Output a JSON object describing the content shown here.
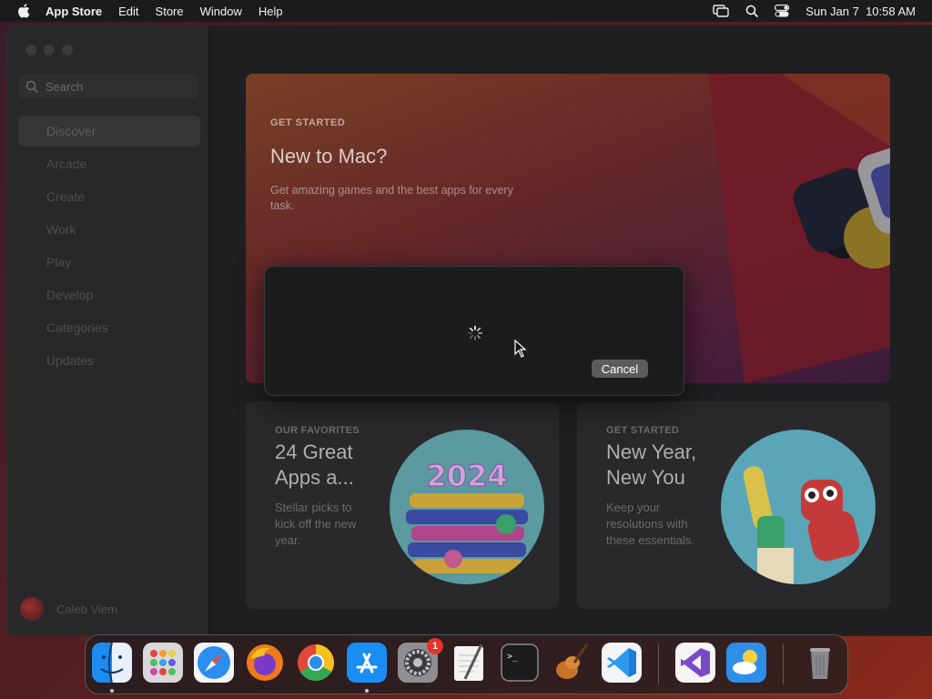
{
  "menubar": {
    "apple_icon": "apple-logo-icon",
    "app_name": "App Store",
    "menus": [
      "Edit",
      "Store",
      "Window",
      "Help"
    ],
    "status_icons": [
      "screen-mirroring-icon",
      "spotlight-search-icon",
      "control-center-icon"
    ],
    "clock": "Sun Jan 7  10:58 AM"
  },
  "sidebar": {
    "search_placeholder": "Search",
    "items": [
      {
        "label": "Discover",
        "active": true
      },
      {
        "label": "Arcade"
      },
      {
        "label": "Create"
      },
      {
        "label": "Work"
      },
      {
        "label": "Play"
      },
      {
        "label": "Develop"
      },
      {
        "label": "Categories"
      },
      {
        "label": "Updates"
      }
    ],
    "account_name": "Caleb Viem"
  },
  "hero": {
    "eyebrow": "GET STARTED",
    "title": "New to Mac?",
    "description": "Get amazing games and the best apps for every task."
  },
  "cards": [
    {
      "eyebrow": "OUR FAVORITES",
      "title": "24 Great Apps a...",
      "description": "Stellar picks to kick off the new year.",
      "art_text": "2024"
    },
    {
      "eyebrow": "GET STARTED",
      "title": "New Year, New You",
      "description": "Keep your resolutions with these essentials."
    }
  ],
  "dialog": {
    "cancel_label": "Cancel"
  },
  "dock": {
    "apps": [
      "Finder",
      "Launchpad",
      "Safari",
      "Firefox",
      "Chrome",
      "App Store",
      "System Settings",
      "TextEdit",
      "Terminal",
      "GarageBand",
      "Visual Studio Code",
      "Visual Studio",
      "Weather",
      "Trash"
    ],
    "settings_badge": "1"
  },
  "colors": {
    "accent_red": "#e5342b",
    "window_bg": "#1f1f21",
    "sidebar_bg": "#28282a"
  }
}
